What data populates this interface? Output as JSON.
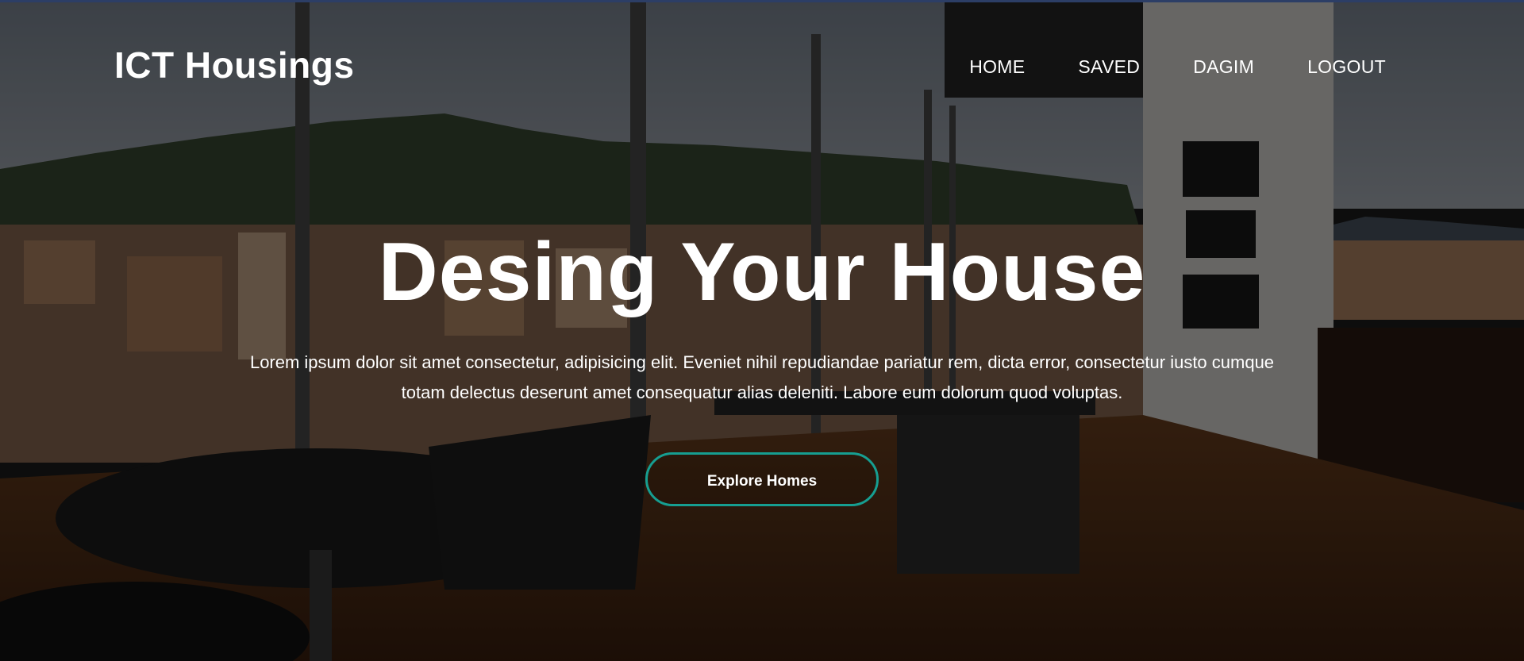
{
  "navbar": {
    "brand": "ICT Housings",
    "links": [
      {
        "label": "HOME"
      },
      {
        "label": "SAVED"
      },
      {
        "label": "DAGIM"
      },
      {
        "label": "LOGOUT"
      }
    ]
  },
  "hero": {
    "headline": "Desing Your House",
    "lead": "Lorem ipsum dolor sit amet consectetur, adipisicing elit. Eveniet nihil repudiandae pariatur rem, dicta error, consectetur iusto cumque totam delectus deserunt amet consequatur alias deleniti. Labore eum dolorum quod voluptas.",
    "cta_label": "Explore Homes"
  },
  "colors": {
    "accent": "#169e91",
    "text": "#ffffff",
    "top_border": "#2c3e66"
  }
}
